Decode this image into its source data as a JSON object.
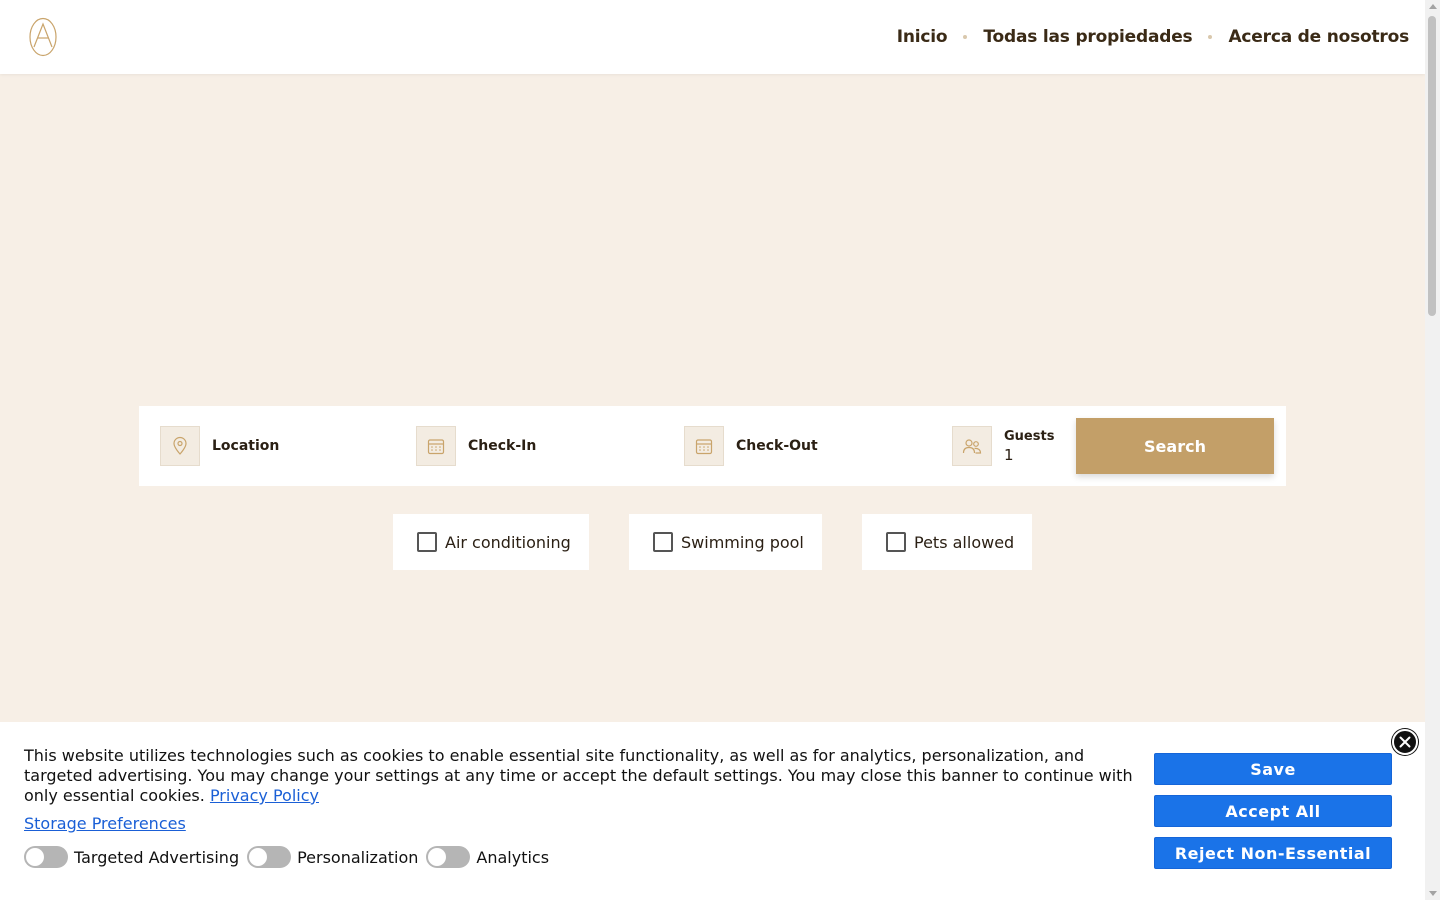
{
  "header": {
    "nav": {
      "home": "Inicio",
      "all_properties": "Todas las propiedades",
      "about": "Acerca de nosotros"
    }
  },
  "search": {
    "location_label": "Location",
    "checkin_label": "Check-In",
    "checkout_label": "Check-Out",
    "guests_label": "Guests",
    "guests_value": "1",
    "button_label": "Search"
  },
  "filters": [
    {
      "label": "Air conditioning",
      "checked": false
    },
    {
      "label": "Swimming pool",
      "checked": false
    },
    {
      "label": "Pets allowed",
      "checked": false
    }
  ],
  "cookie_banner": {
    "text": "This website utilizes technologies such as cookies to enable essential site functionality, as well as for analytics, personalization, and targeted advertising. You may change your settings at any time or accept the default settings. You may close this banner to continue with only essential cookies.",
    "privacy_link": "Privacy Policy",
    "storage_link": "Storage Preferences",
    "toggles": [
      {
        "label": "Targeted Advertising",
        "on": false
      },
      {
        "label": "Personalization",
        "on": false
      },
      {
        "label": "Analytics",
        "on": false
      }
    ],
    "buttons": {
      "save": "Save",
      "accept_all": "Accept All",
      "reject": "Reject Non-Essential"
    }
  },
  "colors": {
    "accent": "#c39f68",
    "page_bg": "#f7efe6",
    "nav_text": "#3a2a16",
    "cookie_button": "#1a73e8"
  },
  "icons": [
    "logo-icon",
    "location-pin-icon",
    "calendar-icon",
    "guests-icon",
    "close-icon"
  ]
}
